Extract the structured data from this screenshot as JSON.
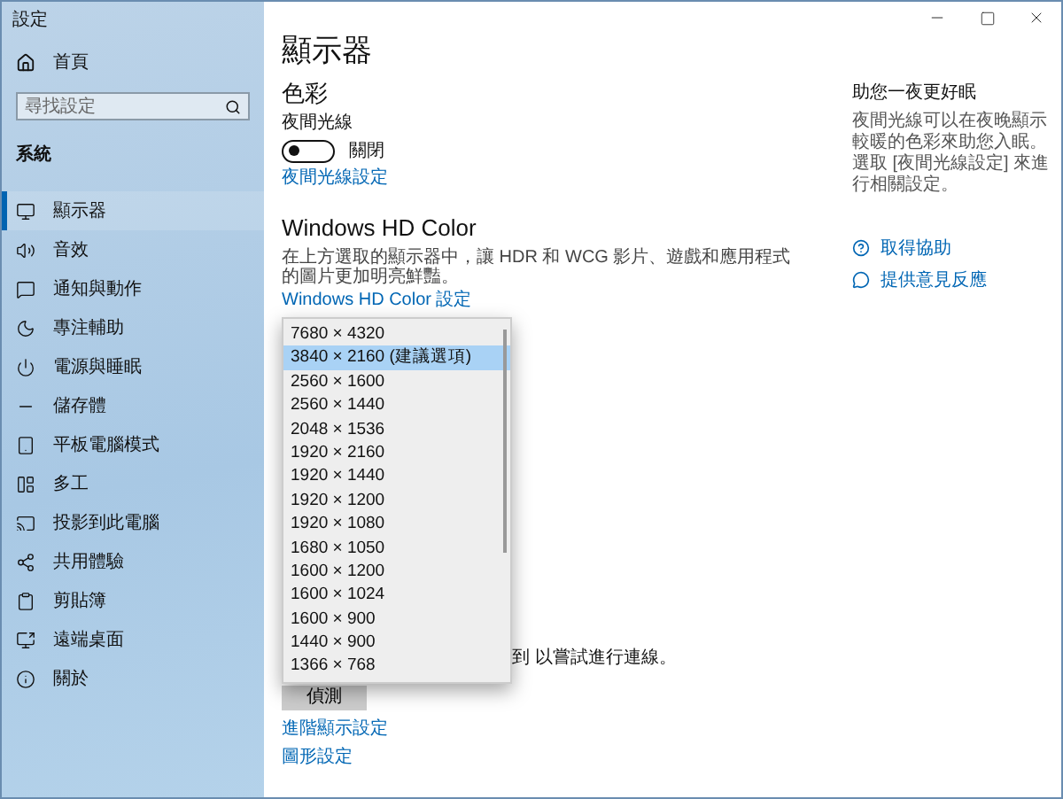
{
  "window": {
    "title": "設定"
  },
  "sidebar": {
    "home": "首頁",
    "search": {
      "placeholder": "尋找設定"
    },
    "section": "系統",
    "items": [
      {
        "label": "顯示器",
        "selected": true
      },
      {
        "label": "音效",
        "selected": false
      },
      {
        "label": "通知與動作",
        "selected": false
      },
      {
        "label": "專注輔助",
        "selected": false
      },
      {
        "label": "電源與睡眠",
        "selected": false
      },
      {
        "label": "儲存體",
        "selected": false
      },
      {
        "label": "平板電腦模式",
        "selected": false
      },
      {
        "label": "多工",
        "selected": false
      },
      {
        "label": "投影到此電腦",
        "selected": false
      },
      {
        "label": "共用體驗",
        "selected": false
      },
      {
        "label": "剪貼簿",
        "selected": false
      },
      {
        "label": "遠端桌面",
        "selected": false
      },
      {
        "label": "關於",
        "selected": false
      }
    ]
  },
  "main": {
    "title": "顯示器",
    "color_heading": "色彩",
    "night_light": {
      "label": "夜間光線",
      "on": false,
      "state_text": "關閉"
    },
    "night_light_link": "夜間光線設定",
    "hd_heading": "Windows HD Color",
    "hd_description": "在上方選取的顯示器中，讓 HDR 和 WCG 影片、遊戲和應用程式的圖片更加明亮鮮豔。",
    "hd_link": "Windows HD Color 設定",
    "partial_text": "到 以嘗試進行連線。",
    "detect_button": "偵測",
    "links": [
      "進階顯示設定",
      "圖形設定"
    ]
  },
  "resolution_dropdown": {
    "options": [
      {
        "label": "7680 × 4320",
        "selected": false
      },
      {
        "label": "3840 × 2160 (建議選項)",
        "selected": true
      },
      {
        "label": "2560 × 1600",
        "selected": false
      },
      {
        "label": "2560 × 1440",
        "selected": false
      },
      {
        "label": "2048 × 1536",
        "selected": false
      },
      {
        "label": "1920 × 2160",
        "selected": false
      },
      {
        "label": "1920 × 1440",
        "selected": false
      },
      {
        "label": "1920 × 1200",
        "selected": false
      },
      {
        "label": "1920 × 1080",
        "selected": false
      },
      {
        "label": "1680 × 1050",
        "selected": false
      },
      {
        "label": "1600 × 1200",
        "selected": false
      },
      {
        "label": "1600 × 1024",
        "selected": false
      },
      {
        "label": "1600 × 900",
        "selected": false
      },
      {
        "label": "1440 × 900",
        "selected": false
      },
      {
        "label": "1366 × 768",
        "selected": false
      }
    ]
  },
  "aside": {
    "title": "助您一夜更好眠",
    "text": "夜間光線可以在夜晚顯示較暖的色彩來助您入眠。選取 [夜間光線設定] 來進行相關設定。",
    "links": [
      "取得協助",
      "提供意見反應"
    ]
  }
}
